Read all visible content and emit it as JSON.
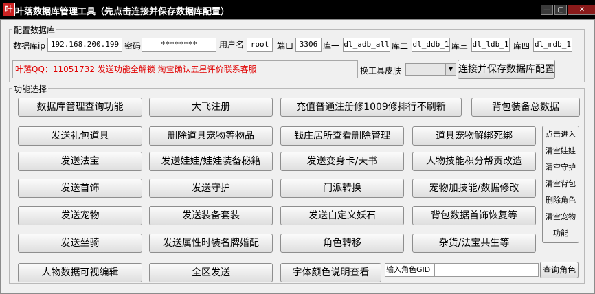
{
  "title": {
    "icon": "game-app-icon",
    "text": "叶落数据库管理工具（先点击连接并保存数据库配置）",
    "minimize": "—",
    "maximize": "▢",
    "close": "✕"
  },
  "db_config": {
    "legend": "配置数据库",
    "ip_label": "数据库ip",
    "ip_value": "192.168.200.199",
    "password_label": "密码",
    "password_value": "********",
    "user_label": "用户名",
    "user_value": "root",
    "port_label": "端口",
    "port_value": "3306",
    "db1_label": "库一",
    "db1_value": "dl_adb_all",
    "db2_label": "库二",
    "db2_value": "dl_ddb_1",
    "db3_label": "库三",
    "db3_value": "dl_ldb_1",
    "db4_label": "库四",
    "db4_value": "dl_mdb_1",
    "notice": "叶落QQ：11051732 发送功能全解锁 淘宝确认五星评价联系客服",
    "skin_label": "换工具皮肤",
    "skin_value": "",
    "connect_button": "连接并保存数据库配置"
  },
  "functions": {
    "legend": "功能选择",
    "row1": [
      "数据库管理查询功能",
      "大飞注册",
      "充值普通注册修1009修排行不刷新",
      "背包装备总数据"
    ],
    "row2": [
      "发送礼包道具",
      "删除道具宠物等物品",
      "钱庄居所查看删除管理",
      "道具宠物解绑死绑"
    ],
    "row3": [
      "发送法宝",
      "发送娃娃/娃娃装备秘籍",
      "发送变身卡/天书",
      "人物技能积分帮贡改造"
    ],
    "row4": [
      "发送首饰",
      "发送守护",
      "门派转换",
      "宠物加技能/数据修改"
    ],
    "row5": [
      "发送宠物",
      "发送装备套装",
      "发送自定义妖石",
      "背包数据首饰恢复等"
    ],
    "row6": [
      "发送坐骑",
      "发送属性时装名牌婚配",
      "角色转移",
      "杂货/法宝共生等"
    ],
    "row7": [
      "人物数据可视编辑",
      "全区发送",
      "字体颜色说明查看"
    ],
    "side_panel": [
      "点击进入",
      "清空娃娃",
      "清空守护",
      "清空背包",
      "删除角色",
      "清空宠物",
      "功能"
    ],
    "gid_label": "输入角色GID",
    "gid_value": "",
    "query_role_button": "查询角色"
  }
}
